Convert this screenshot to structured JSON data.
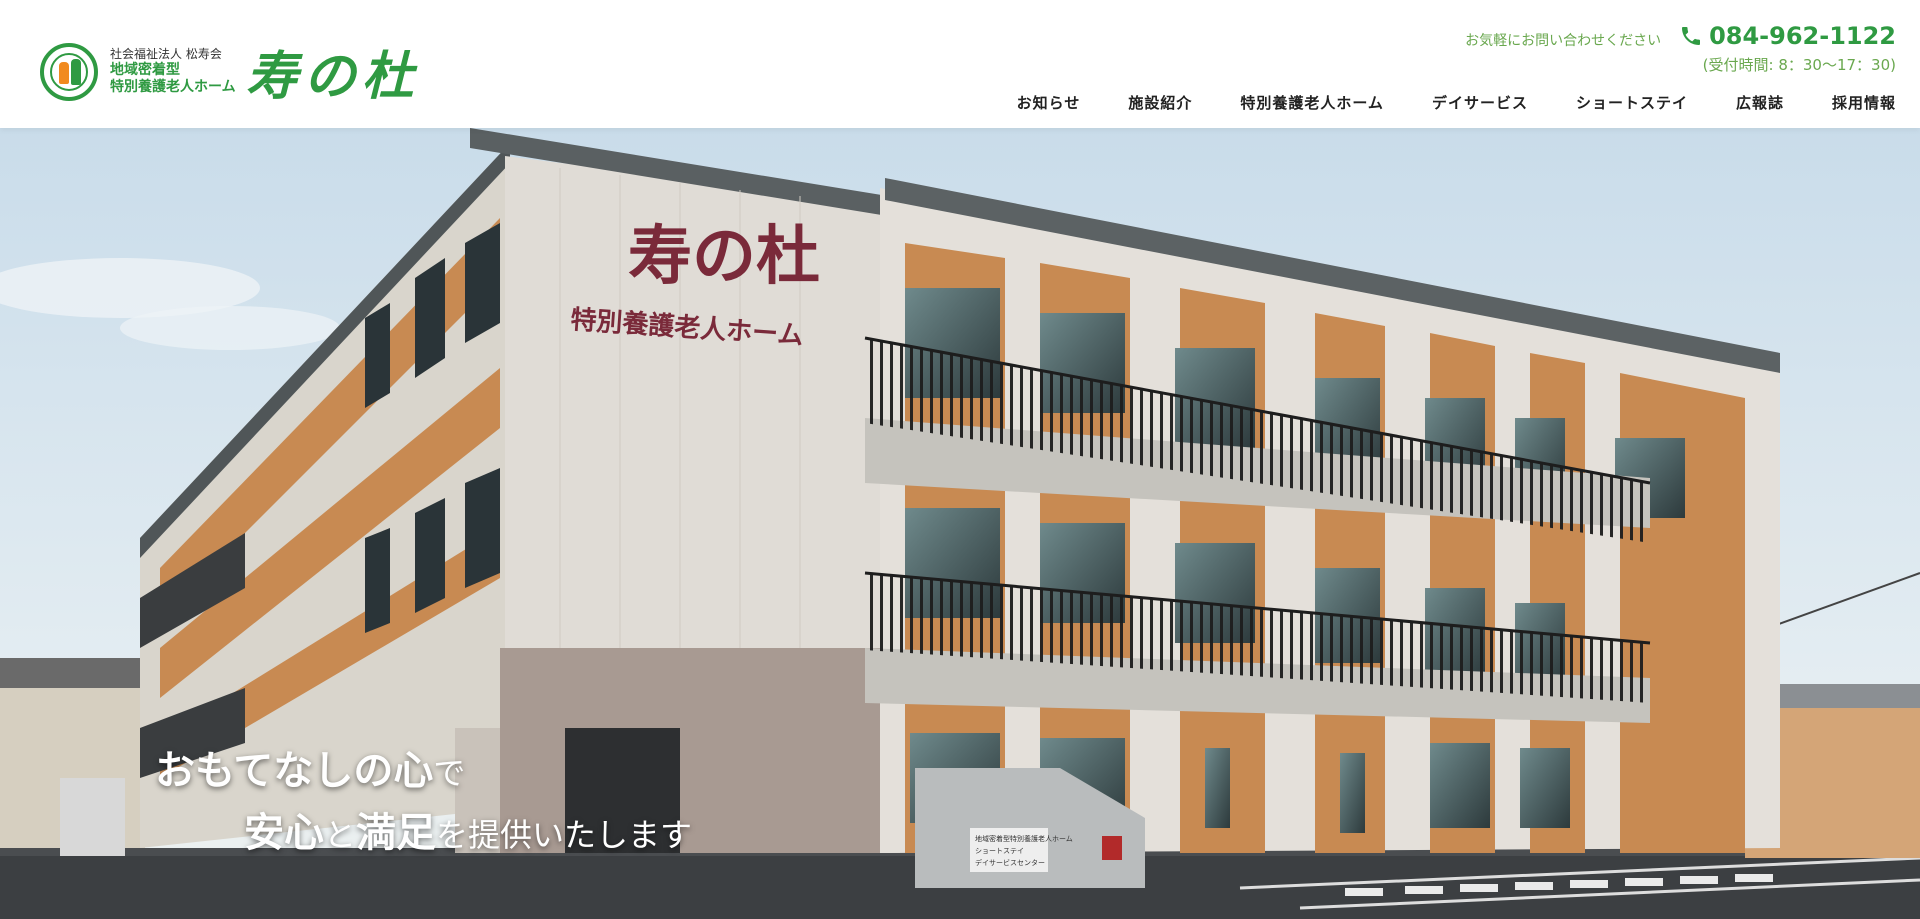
{
  "header": {
    "org_label": "社会福祉法人 松寿会",
    "facility_type_1": "地域密着型",
    "facility_type_2": "特別養護老人ホーム",
    "logo_script": "寿の杜",
    "contact_prompt": "お気軽にお問い合わせください",
    "phone": "084-962-1122",
    "hours": "(受付時間: 8：30〜17：30)"
  },
  "nav": {
    "items": [
      {
        "label": "お知らせ"
      },
      {
        "label": "施設紹介"
      },
      {
        "label": "特別養護老人ホーム"
      },
      {
        "label": "デイサービス"
      },
      {
        "label": "ショートステイ"
      },
      {
        "label": "広報誌"
      },
      {
        "label": "採用情報"
      }
    ]
  },
  "hero": {
    "building_sign_main": "寿の杜",
    "building_sign_sub": "特別養護老人ホーム",
    "monument_line1": "地域密着型特別養護老人ホーム",
    "monument_line2": "ショートステイ",
    "monument_line3": "デイサービスセンター",
    "catch_1a": "おもてなし",
    "catch_1b": "の",
    "catch_1c": "心",
    "catch_1d": "で",
    "catch_2a": "安心",
    "catch_2b": "と",
    "catch_2c": "満足",
    "catch_2d": "を提供いたします"
  },
  "colors": {
    "brand_green": "#2f9a42",
    "light_green": "#6aa84f",
    "facade_orange": "#c98a55",
    "sign_maroon": "#7a2a3a"
  }
}
